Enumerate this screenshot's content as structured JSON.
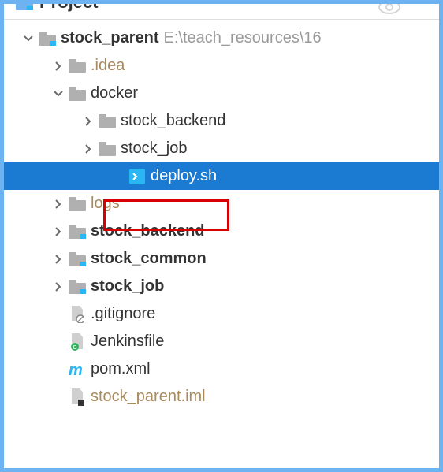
{
  "header": {
    "fragment_text": "Project"
  },
  "tree": {
    "root": {
      "label": "stock_parent",
      "path_hint": "E:\\teach_resources\\16"
    },
    "items": [
      {
        "label": ".idea"
      },
      {
        "label": "docker"
      },
      {
        "label": "stock_backend"
      },
      {
        "label": "stock_job"
      },
      {
        "label": "deploy.sh"
      },
      {
        "label": "logs"
      },
      {
        "label": "stock_backend"
      },
      {
        "label": "stock_common"
      },
      {
        "label": "stock_job"
      },
      {
        "label": ".gitignore"
      },
      {
        "label": "Jenkinsfile"
      },
      {
        "label": "pom.xml"
      },
      {
        "label": "stock_parent.iml"
      }
    ]
  },
  "icons": {
    "folder_color": "#b0b0b0",
    "module_badge_color": "#29b6f2",
    "shell_bg": "#29b6f2",
    "pom_m_color": "#29b6f2",
    "git_badge_color": "#2eb35b"
  }
}
